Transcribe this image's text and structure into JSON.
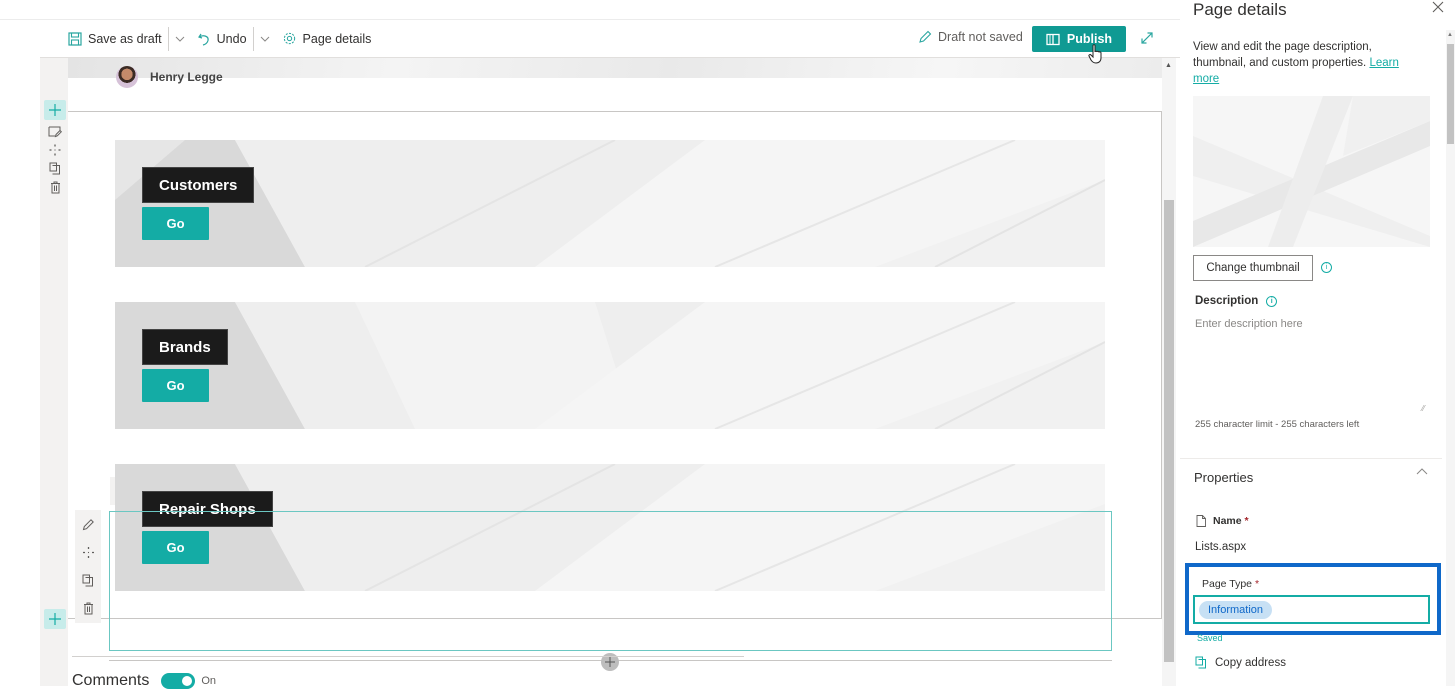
{
  "toolbar": {
    "save_draft": "Save as draft",
    "undo": "Undo",
    "page_details": "Page details",
    "draft_status": "Draft not saved",
    "publish": "Publish"
  },
  "page": {
    "author": "Henry Legge",
    "banners": [
      {
        "title": "Customers",
        "button": "Go"
      },
      {
        "title": "Brands",
        "button": "Go"
      },
      {
        "title": "Repair Shops",
        "button": "Go"
      }
    ],
    "comments_label": "Comments",
    "comments_state": "On"
  },
  "panel": {
    "title": "Page details",
    "intro": "View and edit the page description, thumbnail, and custom properties.",
    "learn_more": "Learn more",
    "change_thumbnail": "Change thumbnail",
    "description_label": "Description",
    "description_placeholder": "Enter description here",
    "description_value": "",
    "char_limit": "255 character limit - 255 characters left",
    "properties_heading": "Properties",
    "name_label": "Name",
    "name_value": "Lists.aspx",
    "page_type_label": "Page Type",
    "page_type_value": "Information",
    "saved": "Saved",
    "copy_address": "Copy address",
    "required_marker": "*"
  },
  "colors": {
    "accent": "#14aca5",
    "publish": "#0f9a93",
    "highlight": "#0f68c9",
    "banner_title_bg": "#1b1b1b"
  }
}
